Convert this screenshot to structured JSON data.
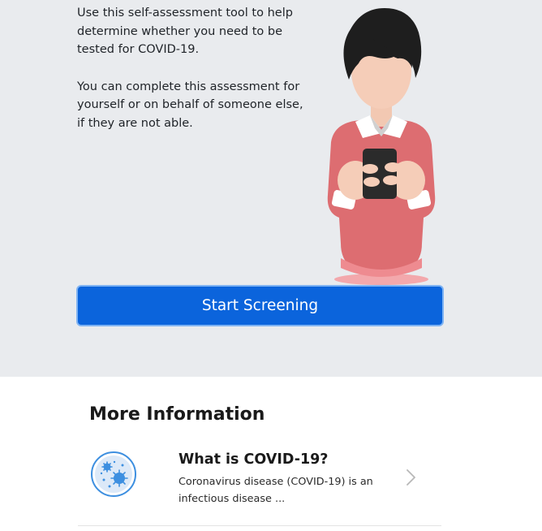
{
  "hero": {
    "paragraph_1": "Use this self-assessment tool to help determine whether you need to be tested for COVID-19.",
    "paragraph_2": "You can complete this assessment for yourself or on behalf of someone else, if they are not able.",
    "button_label": "Start Screening"
  },
  "more_info": {
    "title": "More Information",
    "items": [
      {
        "title": "What is COVID-19?",
        "description": "Coronavirus disease (COVID-19) is an infectious disease ...",
        "icon": "virus-icon"
      }
    ]
  },
  "colors": {
    "hero_background": "#e9ebee",
    "primary_button": "#0b64dc",
    "icon_accent": "#3d8fe0"
  }
}
